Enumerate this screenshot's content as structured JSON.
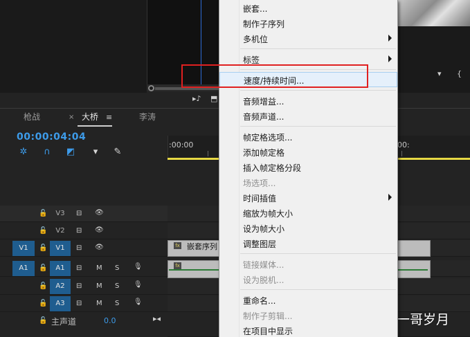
{
  "monitor": {
    "ctrl_icons": [
      "audio-scrub-icon",
      "export-frame-icon"
    ]
  },
  "timeline": {
    "tabs": [
      {
        "label": "枪战",
        "active": false
      },
      {
        "label": "大桥",
        "active": true
      },
      {
        "label": "李涛",
        "active": false
      }
    ],
    "timecode": "00:00:04:04",
    "ruler_start": ":00:00",
    "ruler_end": "00:",
    "tracks": {
      "video": [
        {
          "target": "V3",
          "source": ""
        },
        {
          "target": "V2",
          "source": ""
        },
        {
          "target": "V1",
          "source": "V1"
        }
      ],
      "audio": [
        {
          "target": "A1",
          "source": "A1",
          "m": "M",
          "s": "S"
        },
        {
          "target": "A2",
          "source": "",
          "m": "M",
          "s": "S"
        },
        {
          "target": "A3",
          "source": "",
          "m": "M",
          "s": "S"
        }
      ]
    },
    "clip_label": "嵌套序列",
    "fx_label": "fx",
    "master_label": "主声道",
    "master_value": "0.0"
  },
  "context_menu": {
    "items": [
      {
        "label": "嵌套...",
        "disabled": false,
        "submenu": false
      },
      {
        "label": "制作子序列",
        "disabled": false,
        "submenu": false
      },
      {
        "label": "多机位",
        "disabled": false,
        "submenu": true
      },
      {
        "label": "标签",
        "disabled": false,
        "submenu": true
      },
      {
        "label": "速度/持续时间...",
        "disabled": false,
        "submenu": false,
        "highlighted": true
      },
      {
        "label": "音频增益...",
        "disabled": false,
        "submenu": false
      },
      {
        "label": "音频声道...",
        "disabled": false,
        "submenu": false
      },
      {
        "label": "帧定格选项...",
        "disabled": false,
        "submenu": false
      },
      {
        "label": "添加帧定格",
        "disabled": false,
        "submenu": false
      },
      {
        "label": "插入帧定格分段",
        "disabled": false,
        "submenu": false
      },
      {
        "label": "场选项...",
        "disabled": true,
        "submenu": false
      },
      {
        "label": "时间插值",
        "disabled": false,
        "submenu": true
      },
      {
        "label": "缩放为帧大小",
        "disabled": false,
        "submenu": false
      },
      {
        "label": "设为帧大小",
        "disabled": false,
        "submenu": false
      },
      {
        "label": "调整图层",
        "disabled": false,
        "submenu": false
      },
      {
        "label": "链接媒体...",
        "disabled": true,
        "submenu": false
      },
      {
        "label": "设为脱机...",
        "disabled": true,
        "submenu": false
      },
      {
        "label": "重命名...",
        "disabled": false,
        "submenu": false
      },
      {
        "label": "制作子剪辑...",
        "disabled": true,
        "submenu": false
      },
      {
        "label": "在项目中显示",
        "disabled": false,
        "submenu": false
      }
    ]
  },
  "watermark": "知乎 @开心一哥岁月",
  "colors": {
    "accent_blue": "#3d9be9",
    "target_blue": "#1f5d8f",
    "highlight_red": "#e02020",
    "work_area_yellow": "#e6d844"
  }
}
